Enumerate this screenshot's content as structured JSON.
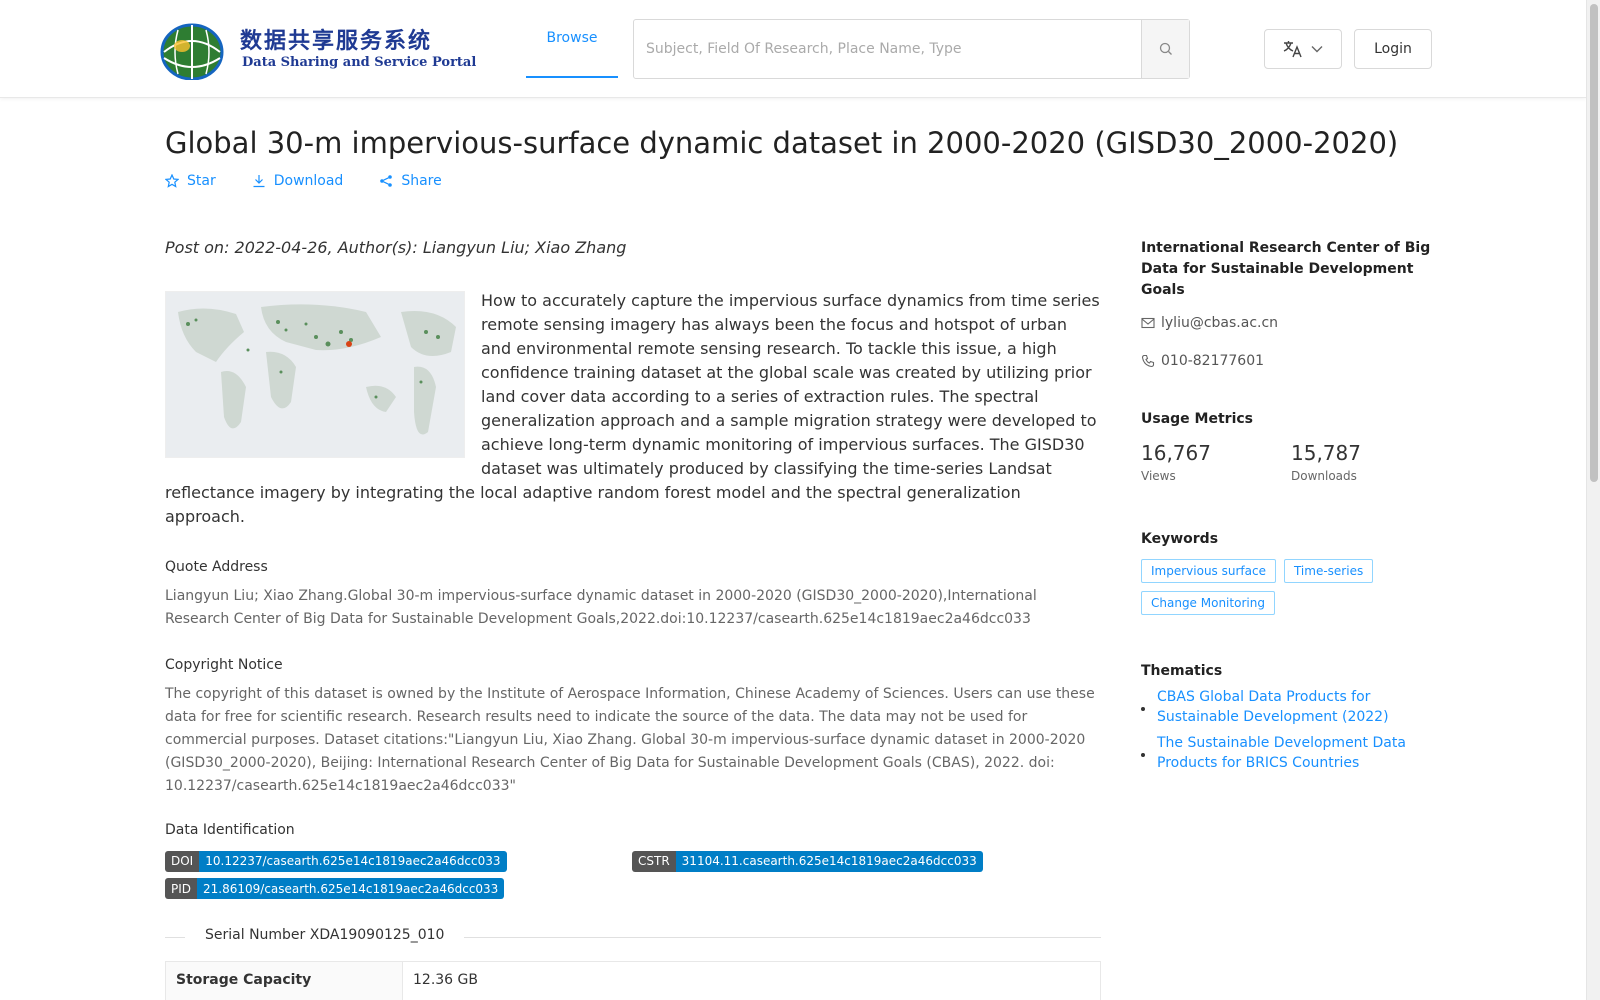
{
  "header": {
    "logo_cn": "数据共享服务系统",
    "logo_en": "Data Sharing and Service Portal",
    "nav_browse": "Browse",
    "search_placeholder": "Subject, Field Of Research, Place Name, Type",
    "login_label": "Login"
  },
  "dataset": {
    "title": "Global 30-m impervious-surface dynamic dataset in 2000-2020 (GISD30_2000-2020)",
    "actions": {
      "star": "Star",
      "download": "Download",
      "share": "Share"
    },
    "post_on": "Post on: 2022-04-26, Author(s): Liangyun Liu; Xiao Zhang",
    "description": "How to accurately capture the impervious surface dynamics from time series remote sensing imagery has always been the focus and hotspot of urban and environmental remote sensing research. To tackle this issue, a high confidence training dataset at the global scale was created by utilizing prior land cover data according to a series of extraction rules. The spectral generalization approach and a sample migration strategy were developed to achieve long-term dynamic monitoring of impervious surfaces. The GISD30 dataset was ultimately produced by classifying the time-series Landsat reflectance imagery by integrating the local adaptive random forest model and the spectral generalization approach.",
    "quote_title": "Quote Address",
    "quote_text": "Liangyun Liu; Xiao Zhang.Global 30-m impervious-surface dynamic dataset in 2000-2020 (GISD30_2000-2020),International Research Center of Big Data for Sustainable Development Goals,2022.doi:10.12237/casearth.625e14c1819aec2a46dcc033",
    "copyright_title": "Copyright Notice",
    "copyright_text": "The copyright of this dataset is owned by the Institute of Aerospace Information, Chinese Academy of Sciences. Users can use these data for free for scientific research. Research results need to indicate the source of the data. The data may not be used for commercial purposes. Dataset citations:\"Liangyun Liu, Xiao Zhang. Global 30-m impervious-surface dynamic dataset in 2000-2020 (GISD30_2000-2020), Beijing: International Research Center of Big Data for Sustainable Development Goals (CBAS), 2022. doi: 10.12237/casearth.625e14c1819aec2a46dcc033\"",
    "identification_title": "Data Identification",
    "identifiers": {
      "doi": {
        "key": "DOI",
        "value": "10.12237/casearth.625e14c1819aec2a46dcc033"
      },
      "cstr": {
        "key": "CSTR",
        "value": "31104.11.casearth.625e14c1819aec2a46dcc033"
      },
      "pid": {
        "key": "PID",
        "value": "21.86109/casearth.625e14c1819aec2a46dcc033"
      }
    },
    "serial_number": "Serial Number XDA19090125_010",
    "storage_label": "Storage Capacity",
    "storage_value": "12.36 GB"
  },
  "sidebar": {
    "org": "International Research Center of Big Data for Sustainable Development Goals",
    "email": "lyliu@cbas.ac.cn",
    "phone": "010-82177601",
    "usage_title": "Usage Metrics",
    "views_value": "16,767",
    "views_label": "Views",
    "downloads_value": "15,787",
    "downloads_label": "Downloads",
    "keywords_title": "Keywords",
    "keywords": [
      "Impervious surface",
      "Time-series",
      "Change Monitoring"
    ],
    "thematics_title": "Thematics",
    "thematics": [
      "CBAS Global Data Products for Sustainable Development (2022)",
      "The Sustainable Development Data Products for BRICS Countries"
    ]
  },
  "colors": {
    "accent": "#1890ff",
    "badge_key": "#555555",
    "badge_value": "#007ec6"
  }
}
